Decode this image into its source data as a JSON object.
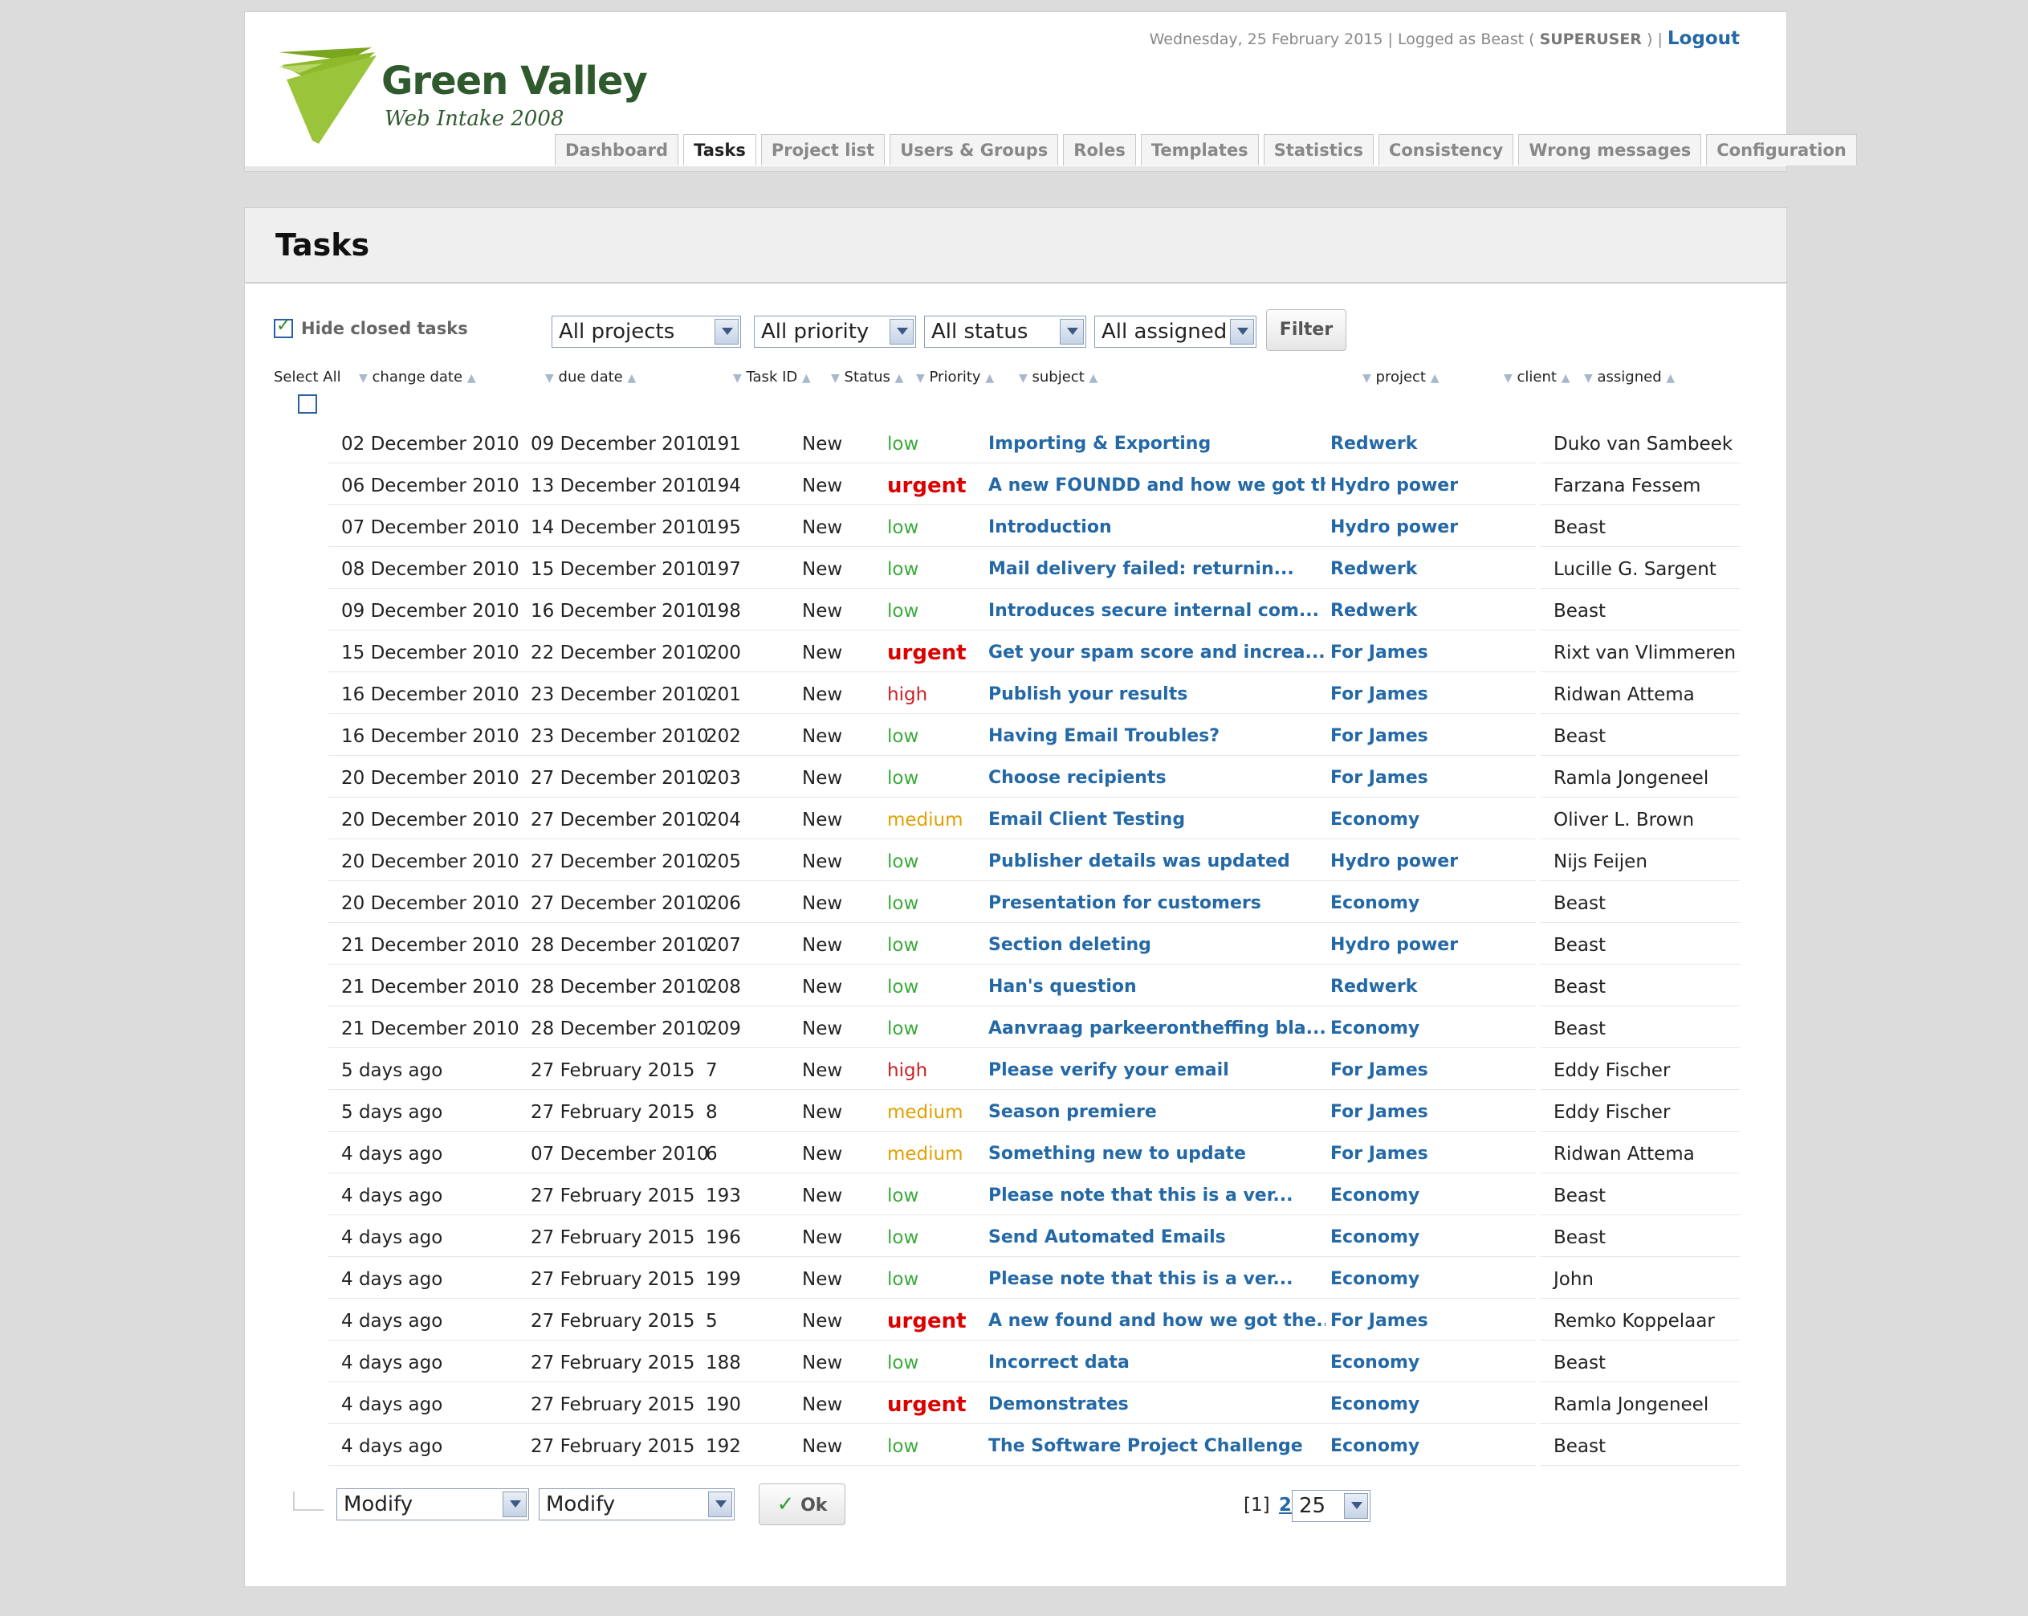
{
  "logo": {
    "title": "Green Valley",
    "subtitle": "Web Intake 2008"
  },
  "topbar": {
    "date": "Wednesday, 25 February 2015",
    "logged_prefix": "Logged as Beast (",
    "role": "SUPERUSER",
    "logged_suffix": ")",
    "logout": "Logout"
  },
  "nav": [
    "Dashboard",
    "Tasks",
    "Project list",
    "Users & Groups",
    "Roles",
    "Templates",
    "Statistics",
    "Consistency",
    "Wrong messages",
    "Configuration"
  ],
  "page": {
    "title": "Tasks"
  },
  "filters": {
    "hide_closed_label": "Hide closed tasks",
    "project": "All projects",
    "priority": "All priority",
    "status": "All status",
    "assigned": "All assigned",
    "filter_button": "Filter"
  },
  "columns": {
    "select_all": "Select All",
    "change_date": "change date",
    "due_date": "due date",
    "task_id": "Task ID",
    "status": "Status",
    "priority": "Priority",
    "subject": "subject",
    "project": "project",
    "client": "client",
    "assigned": "assigned"
  },
  "rows": [
    {
      "change": "02 December 2010",
      "due": "09 December 2010",
      "id": "191",
      "status": "New",
      "priority": "low",
      "subject": "Importing & Exporting",
      "project": "Redwerk",
      "client": "",
      "assigned": "Duko van Sambeek"
    },
    {
      "change": "06 December 2010",
      "due": "13 December 2010",
      "id": "194",
      "status": "New",
      "priority": "urgent",
      "subject": "A new FOUNDD and how we got th...",
      "project": "Hydro power",
      "client": "",
      "assigned": "Farzana Fessem"
    },
    {
      "change": "07 December 2010",
      "due": "14 December 2010",
      "id": "195",
      "status": "New",
      "priority": "low",
      "subject": "Introduction",
      "project": "Hydro power",
      "client": "",
      "assigned": "Beast"
    },
    {
      "change": "08 December 2010",
      "due": "15 December 2010",
      "id": "197",
      "status": "New",
      "priority": "low",
      "subject": "Mail delivery failed: returnin...",
      "project": "Redwerk",
      "client": "",
      "assigned": "Lucille G. Sargent"
    },
    {
      "change": "09 December 2010",
      "due": "16 December 2010",
      "id": "198",
      "status": "New",
      "priority": "low",
      "subject": "Introduces secure internal com...",
      "project": "Redwerk",
      "client": "",
      "assigned": "Beast"
    },
    {
      "change": "15 December 2010",
      "due": "22 December 2010",
      "id": "200",
      "status": "New",
      "priority": "urgent",
      "subject": "Get your spam score and increa...",
      "project": "For James",
      "client": "",
      "assigned": "Rixt van Vlimmeren"
    },
    {
      "change": "16 December 2010",
      "due": "23 December 2010",
      "id": "201",
      "status": "New",
      "priority": "high",
      "subject": "Publish your results",
      "project": "For James",
      "client": "",
      "assigned": "Ridwan Attema"
    },
    {
      "change": "16 December 2010",
      "due": "23 December 2010",
      "id": "202",
      "status": "New",
      "priority": "low",
      "subject": "Having Email Troubles?",
      "project": "For James",
      "client": "",
      "assigned": "Beast"
    },
    {
      "change": "20 December 2010",
      "due": "27 December 2010",
      "id": "203",
      "status": "New",
      "priority": "low",
      "subject": "Choose recipients",
      "project": "For James",
      "client": "",
      "assigned": "Ramla Jongeneel"
    },
    {
      "change": "20 December 2010",
      "due": "27 December 2010",
      "id": "204",
      "status": "New",
      "priority": "medium",
      "subject": "Email Client Testing",
      "project": "Economy",
      "client": "",
      "assigned": "Oliver L. Brown"
    },
    {
      "change": "20 December 2010",
      "due": "27 December 2010",
      "id": "205",
      "status": "New",
      "priority": "low",
      "subject": "Publisher details was updated",
      "project": "Hydro power",
      "client": "",
      "assigned": "Nijs Feijen"
    },
    {
      "change": "20 December 2010",
      "due": "27 December 2010",
      "id": "206",
      "status": "New",
      "priority": "low",
      "subject": "Presentation for customers",
      "project": "Economy",
      "client": "",
      "assigned": "Beast"
    },
    {
      "change": "21 December 2010",
      "due": "28 December 2010",
      "id": "207",
      "status": "New",
      "priority": "low",
      "subject": "Section deleting",
      "project": "Hydro power",
      "client": "",
      "assigned": "Beast"
    },
    {
      "change": "21 December 2010",
      "due": "28 December 2010",
      "id": "208",
      "status": "New",
      "priority": "low",
      "subject": "Han's question",
      "project": "Redwerk",
      "client": "",
      "assigned": "Beast"
    },
    {
      "change": "21 December 2010",
      "due": "28 December 2010",
      "id": "209",
      "status": "New",
      "priority": "low",
      "subject": "Aanvraag parkeerontheffing bla...",
      "project": "Economy",
      "client": "",
      "assigned": "Beast"
    },
    {
      "change": "5 days ago",
      "due": "27 February 2015",
      "id": "7",
      "status": "New",
      "priority": "high",
      "subject": "Please verify your email",
      "project": "For James",
      "client": "",
      "assigned": "Eddy Fischer"
    },
    {
      "change": "5 days ago",
      "due": "27 February 2015",
      "id": "8",
      "status": "New",
      "priority": "medium",
      "subject": "Season premiere",
      "project": "For James",
      "client": "",
      "assigned": "Eddy Fischer"
    },
    {
      "change": "4 days ago",
      "due": "07 December 2010",
      "id": "6",
      "status": "New",
      "priority": "medium",
      "subject": "Something new to update",
      "project": "For James",
      "client": "",
      "assigned": "Ridwan Attema"
    },
    {
      "change": "4 days ago",
      "due": "27 February 2015",
      "id": "193",
      "status": "New",
      "priority": "low",
      "subject": "Please note that this is a ver...",
      "project": "Economy",
      "client": "",
      "assigned": "Beast"
    },
    {
      "change": "4 days ago",
      "due": "27 February 2015",
      "id": "196",
      "status": "New",
      "priority": "low",
      "subject": "Send Automated Emails",
      "project": "Economy",
      "client": "",
      "assigned": "Beast"
    },
    {
      "change": "4 days ago",
      "due": "27 February 2015",
      "id": "199",
      "status": "New",
      "priority": "low",
      "subject": "Please note that this is a ver...",
      "project": "Economy",
      "client": "",
      "assigned": "John"
    },
    {
      "change": "4 days ago",
      "due": "27 February 2015",
      "id": "5",
      "status": "New",
      "priority": "urgent",
      "subject": "A new found and how we got the...",
      "project": "For James",
      "client": "",
      "assigned": "Remko Koppelaar"
    },
    {
      "change": "4 days ago",
      "due": "27 February 2015",
      "id": "188",
      "status": "New",
      "priority": "low",
      "subject": "Incorrect data",
      "project": "Economy",
      "client": "",
      "assigned": "Beast"
    },
    {
      "change": "4 days ago",
      "due": "27 February 2015",
      "id": "190",
      "status": "New",
      "priority": "urgent",
      "subject": "Demonstrates",
      "project": "Economy",
      "client": "",
      "assigned": "Ramla Jongeneel"
    },
    {
      "change": "4 days ago",
      "due": "27 February 2015",
      "id": "192",
      "status": "New",
      "priority": "low",
      "subject": "The Software Project Challenge",
      "project": "Economy",
      "client": "",
      "assigned": "Beast"
    }
  ],
  "footer": {
    "modify1": "Modify",
    "modify2": "Modify",
    "ok": "Ok",
    "page_current": "[1]",
    "page_next": "2",
    "per_page": "25"
  },
  "colors": {
    "link": "#2469a6",
    "low": "#3aaa3a",
    "medium": "#e0a000",
    "high": "#cc2222",
    "urgent": "#dd0000"
  }
}
